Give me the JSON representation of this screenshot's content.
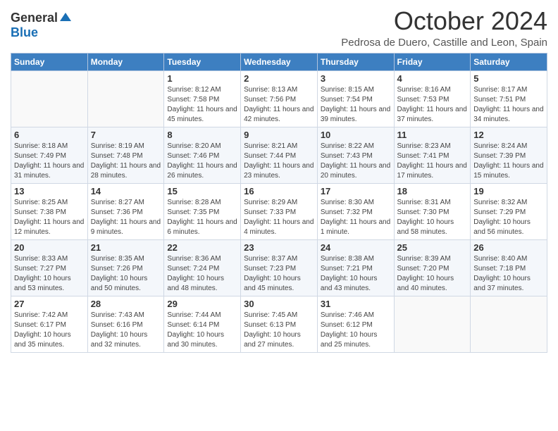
{
  "logo": {
    "line1": "General",
    "line2": "Blue"
  },
  "header": {
    "title": "October 2024",
    "subtitle": "Pedrosa de Duero, Castille and Leon, Spain"
  },
  "weekdays": [
    "Sunday",
    "Monday",
    "Tuesday",
    "Wednesday",
    "Thursday",
    "Friday",
    "Saturday"
  ],
  "weeks": [
    [
      {
        "day": "",
        "info": ""
      },
      {
        "day": "",
        "info": ""
      },
      {
        "day": "1",
        "info": "Sunrise: 8:12 AM\nSunset: 7:58 PM\nDaylight: 11 hours and 45 minutes."
      },
      {
        "day": "2",
        "info": "Sunrise: 8:13 AM\nSunset: 7:56 PM\nDaylight: 11 hours and 42 minutes."
      },
      {
        "day": "3",
        "info": "Sunrise: 8:15 AM\nSunset: 7:54 PM\nDaylight: 11 hours and 39 minutes."
      },
      {
        "day": "4",
        "info": "Sunrise: 8:16 AM\nSunset: 7:53 PM\nDaylight: 11 hours and 37 minutes."
      },
      {
        "day": "5",
        "info": "Sunrise: 8:17 AM\nSunset: 7:51 PM\nDaylight: 11 hours and 34 minutes."
      }
    ],
    [
      {
        "day": "6",
        "info": "Sunrise: 8:18 AM\nSunset: 7:49 PM\nDaylight: 11 hours and 31 minutes."
      },
      {
        "day": "7",
        "info": "Sunrise: 8:19 AM\nSunset: 7:48 PM\nDaylight: 11 hours and 28 minutes."
      },
      {
        "day": "8",
        "info": "Sunrise: 8:20 AM\nSunset: 7:46 PM\nDaylight: 11 hours and 26 minutes."
      },
      {
        "day": "9",
        "info": "Sunrise: 8:21 AM\nSunset: 7:44 PM\nDaylight: 11 hours and 23 minutes."
      },
      {
        "day": "10",
        "info": "Sunrise: 8:22 AM\nSunset: 7:43 PM\nDaylight: 11 hours and 20 minutes."
      },
      {
        "day": "11",
        "info": "Sunrise: 8:23 AM\nSunset: 7:41 PM\nDaylight: 11 hours and 17 minutes."
      },
      {
        "day": "12",
        "info": "Sunrise: 8:24 AM\nSunset: 7:39 PM\nDaylight: 11 hours and 15 minutes."
      }
    ],
    [
      {
        "day": "13",
        "info": "Sunrise: 8:25 AM\nSunset: 7:38 PM\nDaylight: 11 hours and 12 minutes."
      },
      {
        "day": "14",
        "info": "Sunrise: 8:27 AM\nSunset: 7:36 PM\nDaylight: 11 hours and 9 minutes."
      },
      {
        "day": "15",
        "info": "Sunrise: 8:28 AM\nSunset: 7:35 PM\nDaylight: 11 hours and 6 minutes."
      },
      {
        "day": "16",
        "info": "Sunrise: 8:29 AM\nSunset: 7:33 PM\nDaylight: 11 hours and 4 minutes."
      },
      {
        "day": "17",
        "info": "Sunrise: 8:30 AM\nSunset: 7:32 PM\nDaylight: 11 hours and 1 minute."
      },
      {
        "day": "18",
        "info": "Sunrise: 8:31 AM\nSunset: 7:30 PM\nDaylight: 10 hours and 58 minutes."
      },
      {
        "day": "19",
        "info": "Sunrise: 8:32 AM\nSunset: 7:29 PM\nDaylight: 10 hours and 56 minutes."
      }
    ],
    [
      {
        "day": "20",
        "info": "Sunrise: 8:33 AM\nSunset: 7:27 PM\nDaylight: 10 hours and 53 minutes."
      },
      {
        "day": "21",
        "info": "Sunrise: 8:35 AM\nSunset: 7:26 PM\nDaylight: 10 hours and 50 minutes."
      },
      {
        "day": "22",
        "info": "Sunrise: 8:36 AM\nSunset: 7:24 PM\nDaylight: 10 hours and 48 minutes."
      },
      {
        "day": "23",
        "info": "Sunrise: 8:37 AM\nSunset: 7:23 PM\nDaylight: 10 hours and 45 minutes."
      },
      {
        "day": "24",
        "info": "Sunrise: 8:38 AM\nSunset: 7:21 PM\nDaylight: 10 hours and 43 minutes."
      },
      {
        "day": "25",
        "info": "Sunrise: 8:39 AM\nSunset: 7:20 PM\nDaylight: 10 hours and 40 minutes."
      },
      {
        "day": "26",
        "info": "Sunrise: 8:40 AM\nSunset: 7:18 PM\nDaylight: 10 hours and 37 minutes."
      }
    ],
    [
      {
        "day": "27",
        "info": "Sunrise: 7:42 AM\nSunset: 6:17 PM\nDaylight: 10 hours and 35 minutes."
      },
      {
        "day": "28",
        "info": "Sunrise: 7:43 AM\nSunset: 6:16 PM\nDaylight: 10 hours and 32 minutes."
      },
      {
        "day": "29",
        "info": "Sunrise: 7:44 AM\nSunset: 6:14 PM\nDaylight: 10 hours and 30 minutes."
      },
      {
        "day": "30",
        "info": "Sunrise: 7:45 AM\nSunset: 6:13 PM\nDaylight: 10 hours and 27 minutes."
      },
      {
        "day": "31",
        "info": "Sunrise: 7:46 AM\nSunset: 6:12 PM\nDaylight: 10 hours and 25 minutes."
      },
      {
        "day": "",
        "info": ""
      },
      {
        "day": "",
        "info": ""
      }
    ]
  ]
}
